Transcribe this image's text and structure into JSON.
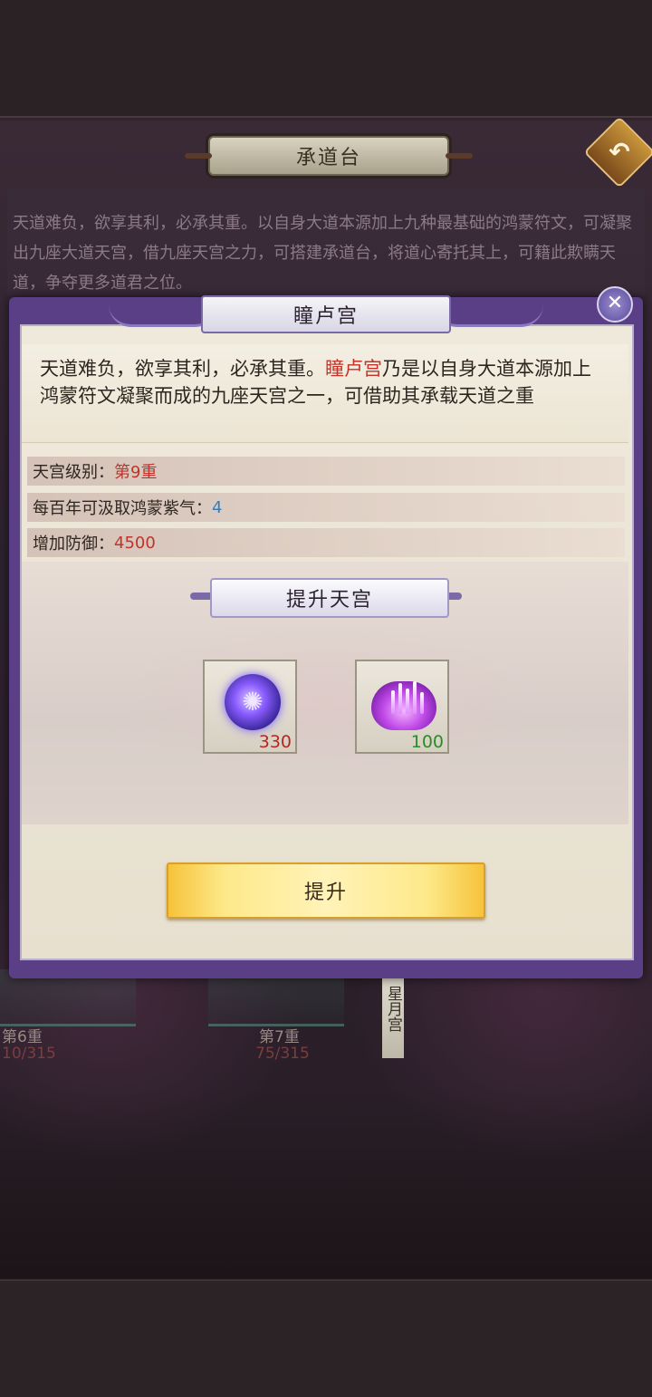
{
  "background": {
    "title": "承道台",
    "description": "天道难负，欲享其利，必承其重。以自身大道本源加上九种最基础的鸿蒙符文，可凝聚出九座大道天宫，借九座天宫之力，可搭建承道台，将道心寄托其上，可籍此欺瞒天道，争夺更多道君之位。",
    "towers": [
      {
        "tier": "第6重",
        "progress": "10/315"
      },
      {
        "tier": "第7重",
        "progress": "75/315"
      }
    ],
    "side_tab": "星月宫"
  },
  "dialog": {
    "title": "瞳卢宫",
    "description_pre": "天道难负，欲享其利，必承其重。",
    "description_highlight": "瞳卢宫",
    "description_post": "乃是以自身大道本源加上鸿蒙符文凝聚而成的九座天宫之一，可借助其承载天道之重",
    "stats": [
      {
        "label": "天宫级别：",
        "value": "第9重"
      },
      {
        "label": "每百年可汲取鸿蒙紫气：",
        "value": "4"
      },
      {
        "label": "增加防御：",
        "value": "4500"
      }
    ],
    "upgrade_header": "提升天宫",
    "materials": [
      {
        "icon": "rune-orb-icon",
        "quantity": "330"
      },
      {
        "icon": "purple-crystal-icon",
        "quantity": "100"
      }
    ],
    "upgrade_button": "提升"
  },
  "colors": {
    "dialog_frame": "#5b3f86",
    "highlight_red": "#c0332a",
    "value_blue": "#2f7fc0",
    "button_gold": "#f6c33a"
  }
}
